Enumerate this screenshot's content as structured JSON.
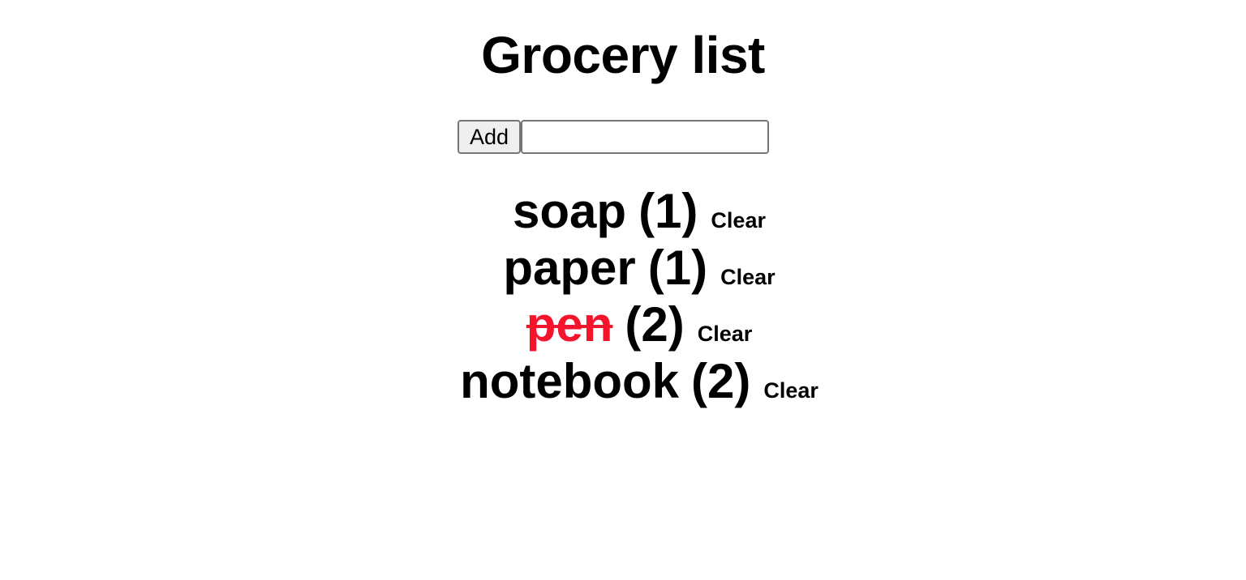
{
  "title": "Grocery list",
  "add_form": {
    "button_label": "Add",
    "input_value": "",
    "input_placeholder": ""
  },
  "items": [
    {
      "name": "soap",
      "count": "(1)",
      "clear_label": "Clear",
      "done": false
    },
    {
      "name": "paper",
      "count": "(1)",
      "clear_label": "Clear",
      "done": false
    },
    {
      "name": "pen",
      "count": "(2)",
      "clear_label": "Clear",
      "done": true
    },
    {
      "name": "notebook",
      "count": "(2)",
      "clear_label": "Clear",
      "done": false
    }
  ],
  "colors": {
    "done_item": "#f4142c"
  }
}
